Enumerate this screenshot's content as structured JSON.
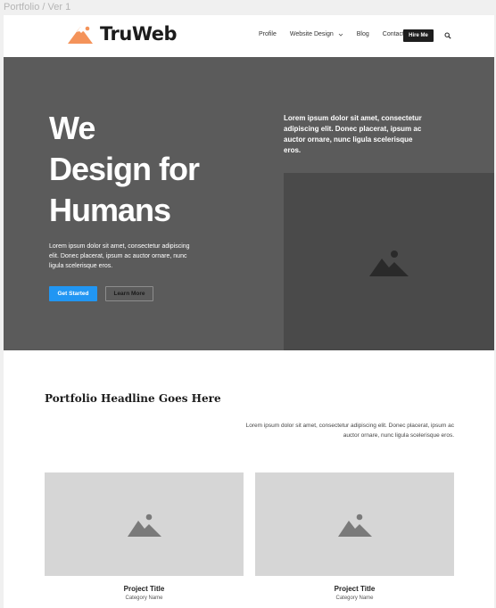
{
  "document": {
    "title": "Portfolio / Ver 1"
  },
  "header": {
    "logo_text": "TruWeb",
    "nav": [
      {
        "label": "Profile"
      },
      {
        "label": "Website Design"
      },
      {
        "label": "Blog"
      },
      {
        "label": "Contact"
      }
    ],
    "cta_label": "Hire Me"
  },
  "hero": {
    "title_lines": [
      "We",
      "Design for",
      "Humans"
    ],
    "description": "Lorem ipsum dolor sit amet, consectetur adipiscing elit. Donec placerat, ipsum ac auctor ornare, nunc ligula scelerisque eros.",
    "primary_button": "Get Started",
    "secondary_button": "Learn More",
    "side_text": "Lorem ipsum dolor sit amet, consectetur adipiscing elit. Donec placerat, ipsum ac auctor ornare, nunc ligula scelerisque eros."
  },
  "portfolio": {
    "headline": "Portfolio Headline Goes Here",
    "description": "Lorem ipsum dolor sit amet, consectetur adipiscing elit. Donec placerat, ipsum ac auctor ornare, nunc ligula scelerisque eros.",
    "cards": [
      {
        "title": "Project Title",
        "category": "Category Name"
      },
      {
        "title": "Project Title",
        "category": "Category Name"
      }
    ]
  },
  "colors": {
    "primary": "#2196f3",
    "hero_bg": "#5b5b5b",
    "logo_orange": "#f4935a",
    "dark": "#1e1e1e"
  },
  "icons": {
    "logo": "mountain-sun-icon",
    "image_placeholder": "image-placeholder-icon",
    "search": "search-icon",
    "dropdown": "chevron-down-icon"
  }
}
